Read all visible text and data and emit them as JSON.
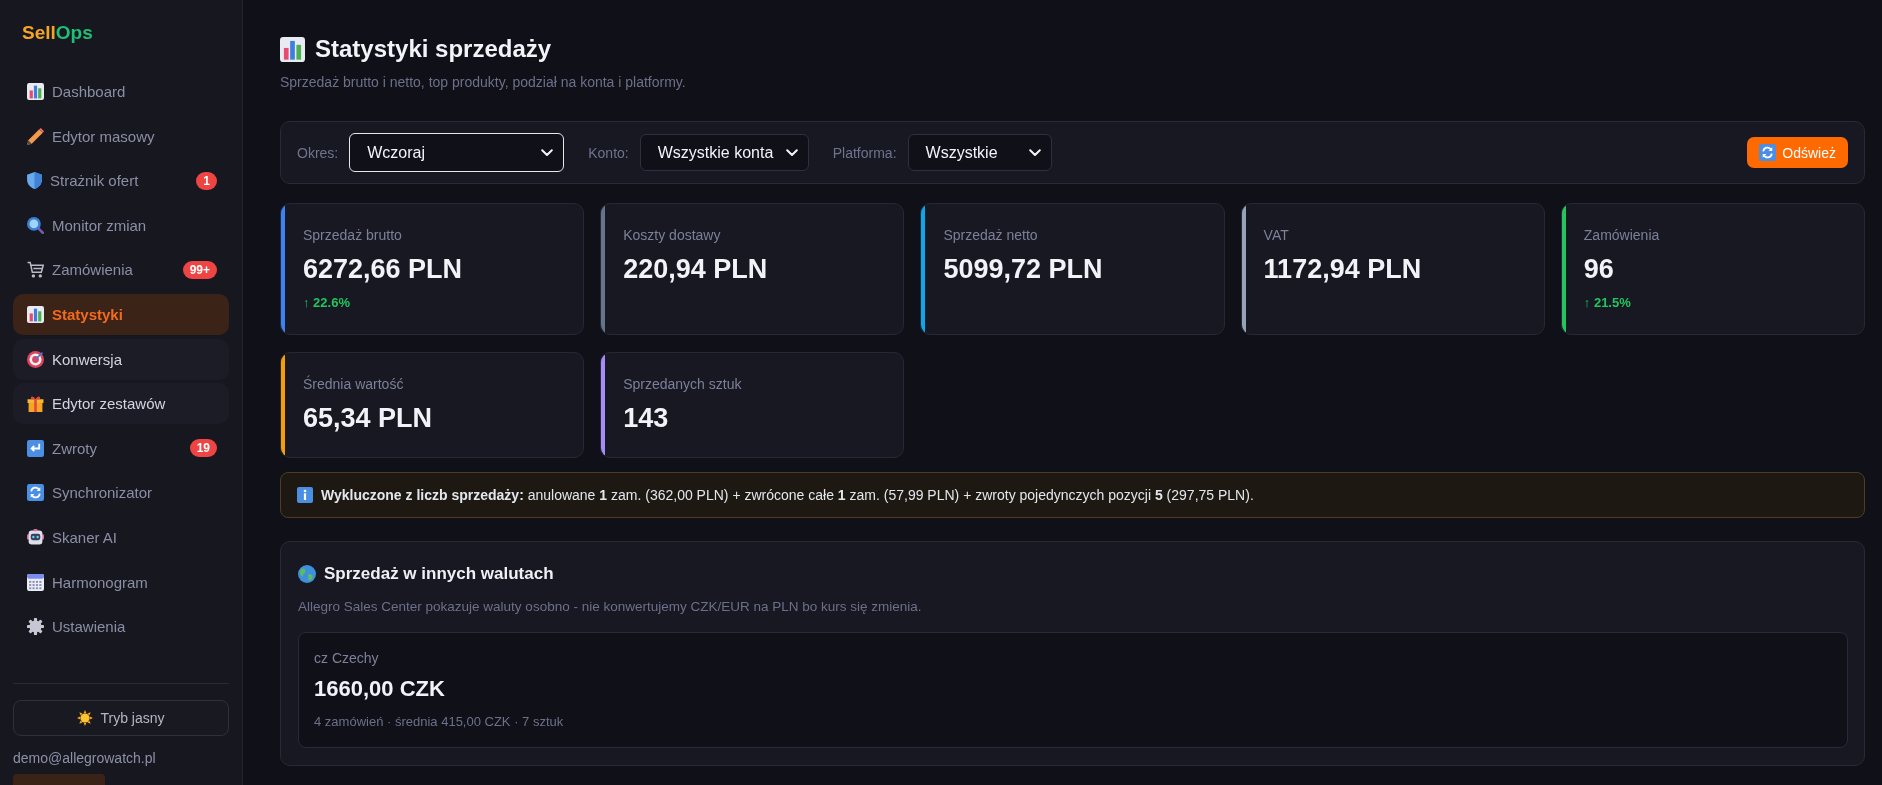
{
  "sidebar": {
    "logo": {
      "primary": "Sell",
      "accent": "Ops"
    },
    "items": [
      {
        "label": "Dashboard",
        "selected": false,
        "highlighted": false
      },
      {
        "label": "Edytor masowy",
        "selected": false,
        "highlighted": false
      },
      {
        "label": "Strażnik ofert",
        "selected": false,
        "highlighted": false,
        "badge": "1"
      },
      {
        "label": "Monitor zmian",
        "selected": false,
        "highlighted": false
      },
      {
        "label": "Zamówienia",
        "selected": false,
        "highlighted": false,
        "badge": "99+"
      },
      {
        "label": "Statystyki",
        "selected": true,
        "highlighted": false
      },
      {
        "label": "Konwersja",
        "selected": false,
        "highlighted": true
      },
      {
        "label": "Edytor zestawów",
        "selected": false,
        "highlighted": true
      },
      {
        "label": "Zwroty",
        "selected": false,
        "highlighted": false,
        "badge": "19"
      },
      {
        "label": "Synchronizator",
        "selected": false,
        "highlighted": false
      },
      {
        "label": "Skaner AI",
        "selected": false,
        "highlighted": false
      },
      {
        "label": "Harmonogram",
        "selected": false,
        "highlighted": false
      },
      {
        "label": "Ustawienia",
        "selected": false,
        "highlighted": false
      }
    ],
    "theme_button": "Tryb jasny",
    "user": {
      "email": "demo@allegrowatch.pl"
    }
  },
  "page": {
    "title": "Statystyki sprzedaży",
    "subtitle": "Sprzedaż brutto i netto, top produkty, podział na konta i platformy."
  },
  "filters": [
    {
      "label": "Okres:",
      "value": "Wczoraj",
      "focused": true
    },
    {
      "label": "Konto:",
      "value": "Wszystkie konta",
      "focused": false
    },
    {
      "label": "Platforma:",
      "value": "Wszystkie",
      "focused": false
    }
  ],
  "refresh_button": "Odśwież",
  "stats": [
    {
      "label": "Sprzedaż brutto",
      "value": "6272,66 PLN",
      "delta": "↑ 22.6%",
      "color": "#3b82f6"
    },
    {
      "label": "Koszty dostawy",
      "value": "220,94 PLN",
      "color": "#64748b"
    },
    {
      "label": "Sprzedaż netto",
      "value": "5099,72 PLN",
      "color": "#0ea5e9"
    },
    {
      "label": "VAT",
      "value": "1172,94 PLN",
      "color": "#94a3b8"
    },
    {
      "label": "Zamówienia",
      "value": "96",
      "delta": "↑ 21.5%",
      "color": "#22c55e"
    },
    {
      "label": "Średnia wartość",
      "value": "65,34 PLN",
      "color": "#f59e0b"
    },
    {
      "label": "Sprzedanych sztuk",
      "value": "143",
      "color": "#a78bfa"
    }
  ],
  "exclusion_note": "**Wykluczone z liczb sprzedaży:** anulowane **1** zam. (362,00 PLN) + zwrócone całe **1** zam. (57,99 PLN) + zwroty pojedynczych pozycji **5** (297,75 PLN).",
  "other_currencies": {
    "title": "Sprzedaż w innych walutach",
    "description": "Allegro Sales Center pokazuje waluty osobno - nie konwertujemy CZK/EUR na PLN bo kurs się zmienia.",
    "entries": [
      {
        "country": "cz Czechy",
        "amount": "1660,00 CZK",
        "details": "4 zamówień · średnia 415,00 CZK · 7 sztuk"
      }
    ]
  }
}
